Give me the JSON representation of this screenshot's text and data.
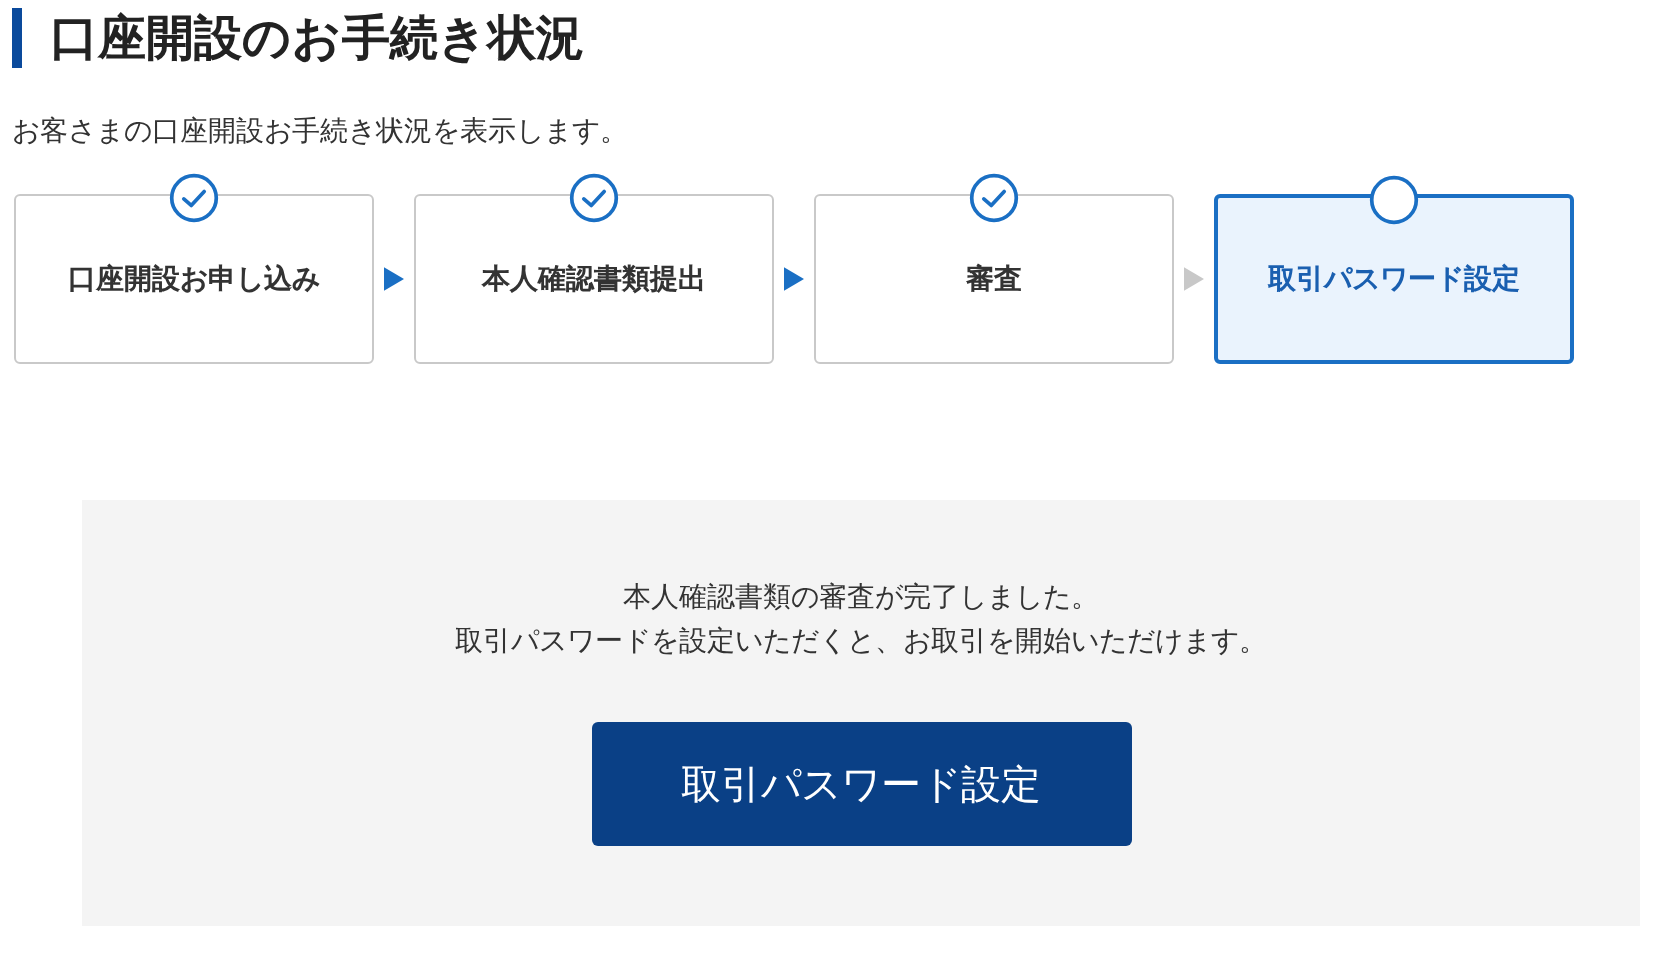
{
  "title": "口座開設のお手続き状況",
  "description": "お客さまの口座開設お手続き状況を表示します。",
  "steps": [
    {
      "label": "口座開設お申し込み",
      "done": true,
      "selected": false
    },
    {
      "label": "本人確認書類提出",
      "done": true,
      "selected": false
    },
    {
      "label": "審査",
      "done": true,
      "selected": false
    },
    {
      "label": "取引パスワード設定",
      "done": false,
      "selected": true
    }
  ],
  "notice": {
    "lines": [
      "本人確認書類の審査が完了しました。",
      "取引パスワードを設定いただくと、お取引を開始いただけます。"
    ],
    "button": "取引パスワード設定"
  }
}
